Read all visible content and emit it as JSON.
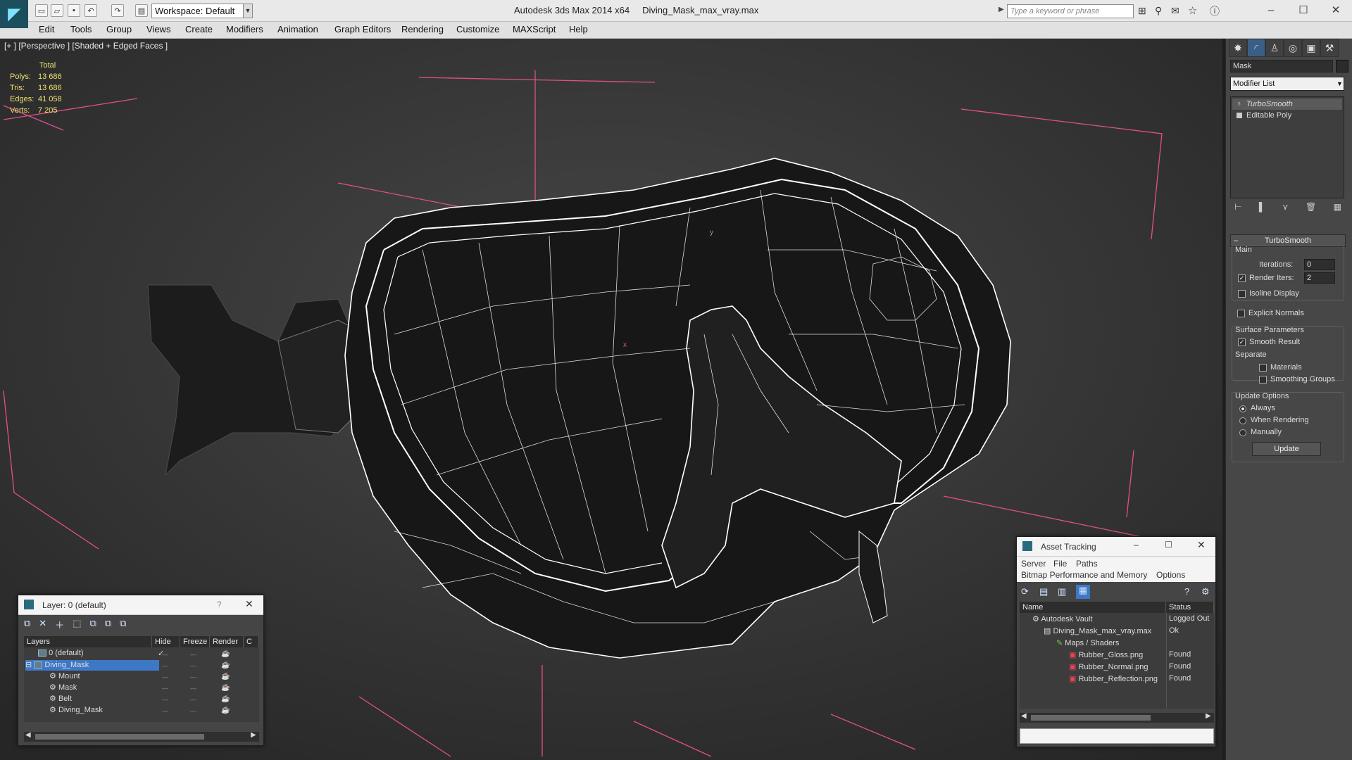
{
  "title_bar": {
    "workspace": "Workspace: Default",
    "app_name": "Autodesk 3ds Max  2014 x64",
    "file_name": "Diving_Mask_max_vray.max",
    "search_placeholder": "Type a keyword or phrase"
  },
  "menu": [
    "Edit",
    "Tools",
    "Group",
    "Views",
    "Create",
    "Modifiers",
    "Animation",
    "Graph Editors",
    "Rendering",
    "Customize",
    "MAXScript",
    "Help"
  ],
  "viewport": {
    "label": "[+ ] [Perspective ] [Shaded + Edged Faces ]",
    "stats": {
      "header": "Total",
      "rows": [
        {
          "k": "Polys:",
          "v": "13 686"
        },
        {
          "k": "Tris:",
          "v": "13 686"
        },
        {
          "k": "Edges:",
          "v": "41 058"
        },
        {
          "k": "Verts:",
          "v": "7 205"
        }
      ]
    },
    "axis_x": "x",
    "axis_y": "y"
  },
  "command_panel": {
    "object_name": "Mask",
    "modifier_list": "Modifier List",
    "stack": [
      "TurboSmooth",
      "Editable Poly"
    ],
    "rollout_title": "TurboSmooth",
    "main_label": "Main",
    "iterations_label": "Iterations:",
    "iterations_value": "0",
    "render_iters_label": "Render Iters:",
    "render_iters_value": "2",
    "isoline_label": "Isoline Display",
    "explicit_normals_label": "Explicit Normals",
    "surface_params_label": "Surface Parameters",
    "smooth_result_label": "Smooth Result",
    "separate_label": "Separate",
    "materials_label": "Materials",
    "smoothing_groups_label": "Smoothing Groups",
    "update_options_label": "Update Options",
    "always_label": "Always",
    "when_rendering_label": "When Rendering",
    "manually_label": "Manually",
    "update_button": "Update"
  },
  "layer_window": {
    "title": "Layer: 0 (default)",
    "help": "?",
    "columns": [
      "Layers",
      "Hide",
      "Freeze",
      "Render",
      "C"
    ],
    "rows": [
      {
        "name": "0 (default)",
        "indent": 1
      },
      {
        "name": "Diving_Mask",
        "indent": 1,
        "selected": true
      },
      {
        "name": "Mount",
        "indent": 2
      },
      {
        "name": "Mask",
        "indent": 2
      },
      {
        "name": "Belt",
        "indent": 2
      },
      {
        "name": "Diving_Mask",
        "indent": 2
      }
    ]
  },
  "asset_window": {
    "title": "Asset Tracking",
    "menu1": [
      "Server",
      "File",
      "Paths"
    ],
    "menu2": [
      "Bitmap Performance and Memory",
      "Options"
    ],
    "columns": [
      "Name",
      "Status"
    ],
    "rows": [
      {
        "name": "Autodesk Vault",
        "status": "Logged Out",
        "indent": 1
      },
      {
        "name": "Diving_Mask_max_vray.max",
        "status": "Ok",
        "indent": 2
      },
      {
        "name": "Maps / Shaders",
        "status": "",
        "indent": 3
      },
      {
        "name": "Rubber_Gloss.png",
        "status": "Found",
        "indent": 4
      },
      {
        "name": "Rubber_Normal.png",
        "status": "Found",
        "indent": 4
      },
      {
        "name": "Rubber_Reflection.png",
        "status": "Found",
        "indent": 4
      }
    ]
  },
  "colors": {
    "viewport_bg": "#3a3a3a",
    "grid_pink": "#e0508a",
    "stats_yellow": "#f0e36c",
    "selection_blue": "#3d78c7"
  }
}
